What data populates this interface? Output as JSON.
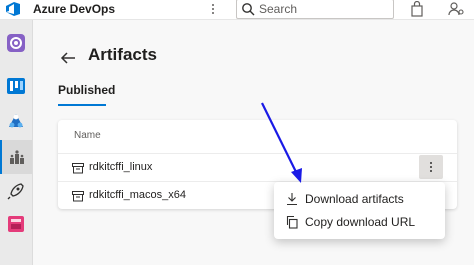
{
  "header": {
    "app_title": "Azure DevOps",
    "search_placeholder": "Search",
    "icons": [
      "azure-devops-logo",
      "more-vertical-icon",
      "search-icon",
      "shopping-bag-icon",
      "user-settings-icon"
    ]
  },
  "sidebar": {
    "items": [
      {
        "name": "project-overview",
        "icon": "project-avatar-icon"
      },
      {
        "name": "boards",
        "icon": "boards-icon"
      },
      {
        "name": "repos",
        "icon": "repos-icon"
      },
      {
        "name": "artifacts",
        "icon": "artifacts-icon",
        "active": true
      },
      {
        "name": "pipelines",
        "icon": "rocket-icon"
      },
      {
        "name": "test-plans",
        "icon": "test-plans-icon"
      }
    ]
  },
  "page": {
    "title": "Artifacts",
    "tabs": [
      {
        "label": "Published",
        "selected": true
      }
    ]
  },
  "table": {
    "column_header": "Name",
    "rows": [
      {
        "name": "rdkitcffi_linux"
      },
      {
        "name": "rdkitcffi_macos_x64"
      }
    ]
  },
  "context_menu": {
    "items": [
      {
        "label": "Download artifacts",
        "icon": "download-icon"
      },
      {
        "label": "Copy download URL",
        "icon": "copy-icon"
      }
    ]
  },
  "colors": {
    "accent": "#0078d4",
    "annotation_arrow": "#1a1ae6"
  }
}
